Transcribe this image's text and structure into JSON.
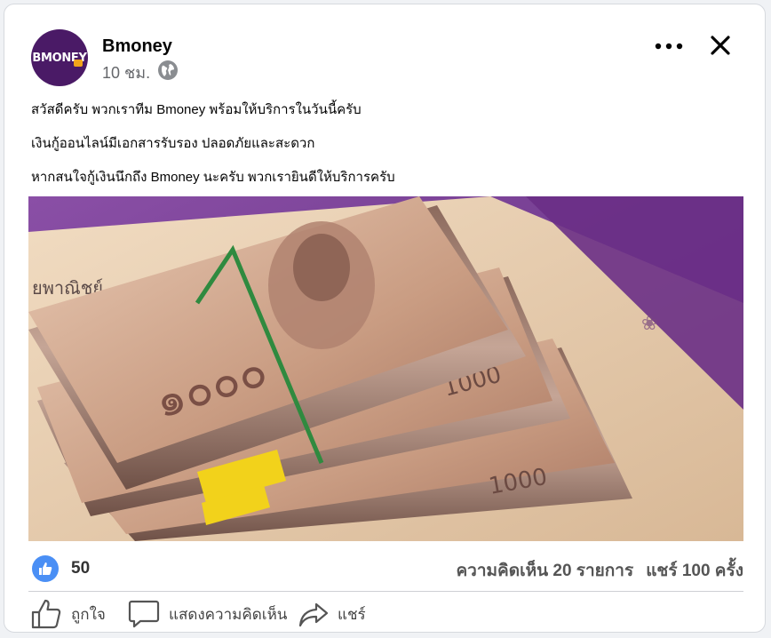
{
  "post": {
    "page_name": "Bmoney",
    "avatar_text": "BMONEY",
    "time": "10 ชม.",
    "lines": [
      "สวัสดีครับ พวกเราทีม Bmoney พร้อมให้บริการในวันนี้ครับ",
      "เงินกู้ออนไลน์มีเอกสารรับรอง ปลอดภัยและสะดวก",
      "หากสนใจกู้เงินนึกถึง Bmoney นะครับ พวกเรายินดีให้บริการครับ"
    ],
    "photo_note": "1000"
  },
  "stats": {
    "likes": "50",
    "comments": "ความคิดเห็น 20 รายการ",
    "shares": "แชร์ 100 ครั้ง"
  },
  "actions": {
    "like_label": "ถูกใจ",
    "comment_label": "แสดงความคิดเห็น",
    "share_label": "แชร์"
  },
  "colors": {
    "accent": "#4a8ff5",
    "avatar_bg": "#4a1a66",
    "banknote": "#b98c77"
  },
  "icons": {
    "more": "more-icon",
    "close": "close-icon",
    "globe": "globe-icon",
    "like": "thumbs-up-icon",
    "comment": "comment-icon",
    "share": "share-icon"
  }
}
